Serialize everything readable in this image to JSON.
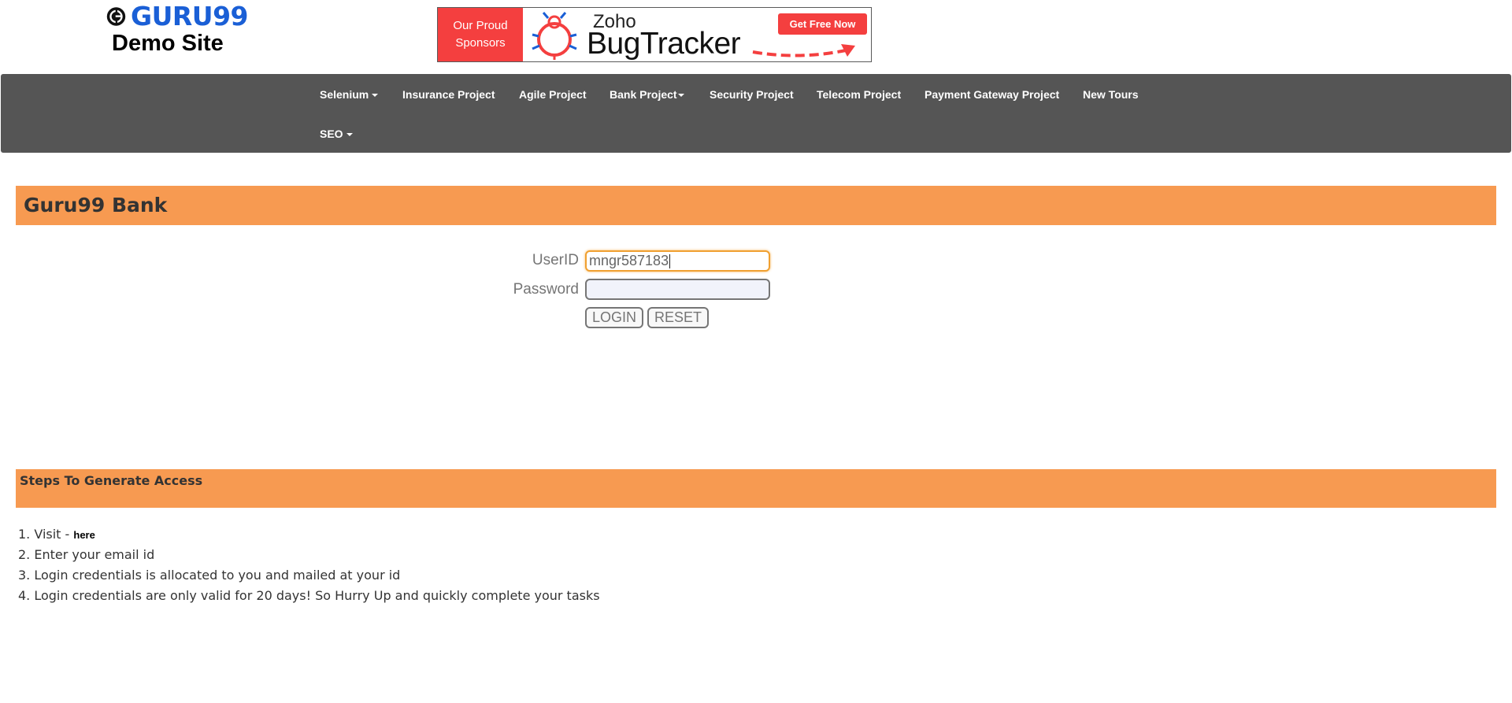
{
  "logo": {
    "brand": "GURU99",
    "subtitle": "Demo Site"
  },
  "banner": {
    "left_line1": "Our Proud",
    "left_line2": "Sponsors",
    "zoho": "Zoho",
    "product": "BugTracker",
    "cta": "Get Free Now"
  },
  "nav": {
    "items": [
      {
        "label": "Selenium",
        "dropdown": true
      },
      {
        "label": "Insurance Project",
        "dropdown": false
      },
      {
        "label": "Agile Project",
        "dropdown": false
      },
      {
        "label": "Bank Project",
        "dropdown": true
      },
      {
        "label": "Security Project",
        "dropdown": false
      },
      {
        "label": "Telecom Project",
        "dropdown": false
      },
      {
        "label": "Payment Gateway Project",
        "dropdown": false
      },
      {
        "label": "New Tours",
        "dropdown": false
      },
      {
        "label": "SEO",
        "dropdown": true
      }
    ]
  },
  "page": {
    "title": "Guru99 Bank"
  },
  "login": {
    "userid_label": "UserID",
    "userid_value": "mngr587183",
    "password_label": "Password",
    "password_value": "",
    "login_button": "LOGIN",
    "reset_button": "RESET"
  },
  "steps": {
    "heading": "Steps To Generate Access",
    "items": [
      {
        "text": "1. Visit - ",
        "link": "here"
      },
      {
        "text": "2. Enter your email id"
      },
      {
        "text": "3. Login credentials is allocated to you and mailed at your id"
      },
      {
        "text": "4. Login credentials are only valid for 20 days! So Hurry Up and quickly complete your tasks"
      }
    ]
  },
  "colors": {
    "accent": "#f79a51",
    "nav_bg": "#555555",
    "brand_blue": "#1a5fd6",
    "sponsor_red": "#f43f3f"
  }
}
